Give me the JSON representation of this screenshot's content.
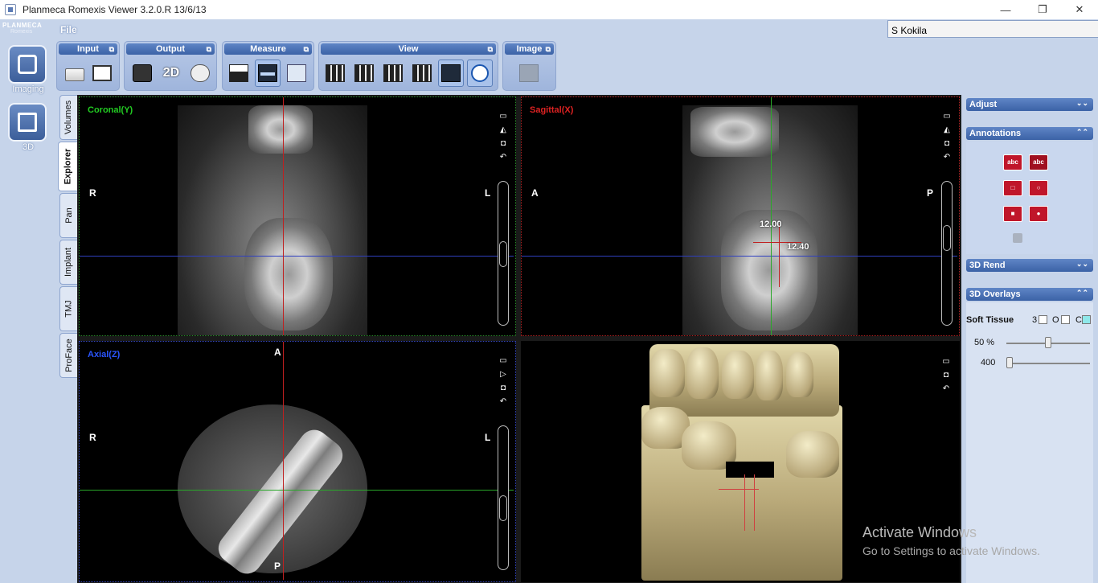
{
  "window": {
    "title": "Planmeca Romexis Viewer 3.2.0.R  13/6/13"
  },
  "brand": {
    "line1": "PLANMECA",
    "line2": "Romexis"
  },
  "nav": [
    {
      "label": "Imaging",
      "icon": "imaging-icon"
    },
    {
      "label": "3D",
      "icon": "3d-icon"
    }
  ],
  "menu": {
    "file": "File"
  },
  "patient": {
    "name": "S Kokila"
  },
  "toolbar": {
    "groups": [
      {
        "label": "Input"
      },
      {
        "label": "Output"
      },
      {
        "label": "Measure"
      },
      {
        "label": "View"
      },
      {
        "label": "Image"
      }
    ],
    "output_2d_label": "2D"
  },
  "side_tabs": [
    "Volumes",
    "Explorer",
    "Pan",
    "Implant",
    "TMJ",
    "ProFace"
  ],
  "viewports": {
    "coronal": {
      "label": "Coronal(Y)",
      "left": "R",
      "right": "L",
      "color": "#22cc22"
    },
    "sagittal": {
      "label": "Sagittal(X)",
      "left": "A",
      "right": "P",
      "color": "#dd2222",
      "measure1": "12.00",
      "measure2": "12.40"
    },
    "axial": {
      "label": "Axial(Z)",
      "left": "R",
      "right": "L",
      "top": "A",
      "bottom": "P",
      "color": "#2244dd"
    }
  },
  "right_panel": {
    "adjust": "Adjust",
    "annotations": "Annotations",
    "anno_text_label": "abc",
    "rend": "3D Rend",
    "overlays": "3D Overlays",
    "soft_tissue": "Soft Tissue",
    "soft_tissue_opts": [
      "3",
      "O",
      "C"
    ],
    "opacity_label": "50 %",
    "threshold_label": "400",
    "opacity_value": 0.5
  },
  "watermark": {
    "line1": "Activate Windows",
    "line2": "Go to Settings to activate Windows."
  }
}
